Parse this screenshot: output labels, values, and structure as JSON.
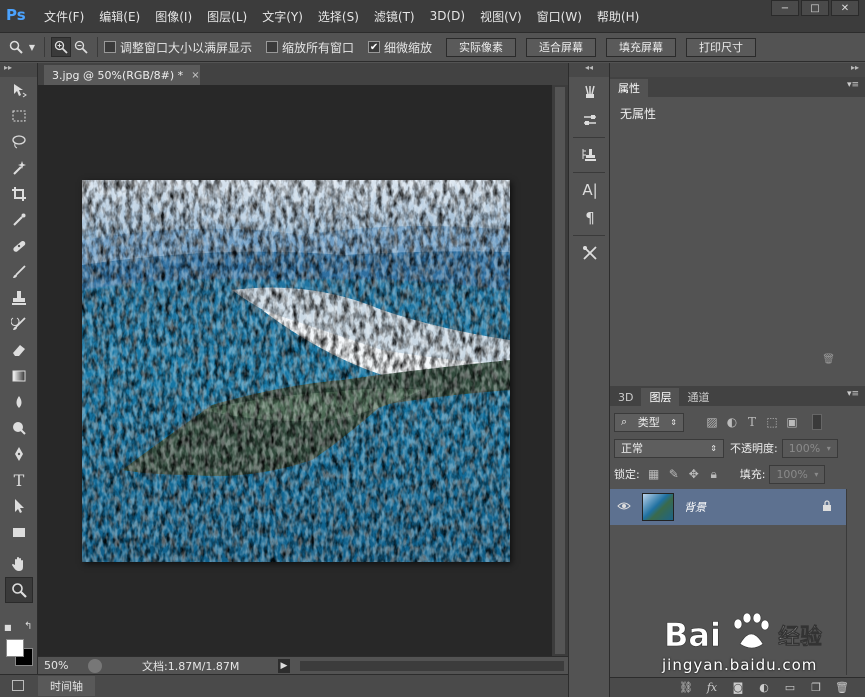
{
  "app": {
    "logo": "Ps"
  },
  "menu": [
    "文件(F)",
    "编辑(E)",
    "图像(I)",
    "图层(L)",
    "文字(Y)",
    "选择(S)",
    "滤镜(T)",
    "3D(D)",
    "视图(V)",
    "窗口(W)",
    "帮助(H)"
  ],
  "window_controls": {
    "minimize": "−",
    "maximize": "□",
    "close": "✕"
  },
  "options": {
    "resize_windows": {
      "label": "调整窗口大小以满屏显示",
      "checked": false
    },
    "zoom_all": {
      "label": "缩放所有窗口",
      "checked": false
    },
    "scrubby_zoom": {
      "label": "细微缩放",
      "checked": true
    },
    "buttons": [
      "实际像素",
      "适合屏幕",
      "填充屏幕",
      "打印尺寸"
    ]
  },
  "document": {
    "tab_title": "3.jpg @ 50%(RGB/8#) *",
    "close": "×"
  },
  "status": {
    "zoom": "50%",
    "doc_size": "文档:1.87M/1.87M",
    "arrow": "▶"
  },
  "timeline": {
    "label": "时间轴"
  },
  "properties": {
    "tab": "属性",
    "empty_text": "无属性"
  },
  "layers": {
    "tabs": [
      "3D",
      "图层",
      "通道"
    ],
    "active_tab": "图层",
    "filter_label": "类型",
    "blend_mode": "正常",
    "opacity_label": "不透明度:",
    "opacity_value": "100%",
    "lock_label": "锁定:",
    "fill_label": "填充:",
    "fill_value": "100%",
    "items": [
      {
        "name": "背景",
        "visible": true,
        "locked": true
      }
    ]
  },
  "watermark": {
    "brand": "Bai 经验",
    "url": "jingyan.baidu.com"
  },
  "colors": {
    "accent_ps": "#4ba3ff",
    "layer_selected": "#5d7190",
    "canvas_bg": "#282828"
  }
}
